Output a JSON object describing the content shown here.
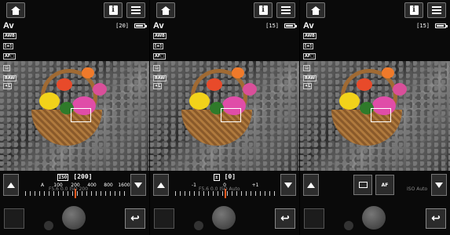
{
  "panels": [
    {
      "mode": "Av",
      "shots": "[20]",
      "setting_tag": "ISO",
      "setting_value": "[200]",
      "scale_labels": [
        "A",
        "100",
        "200",
        "400",
        "800",
        "1600"
      ],
      "ghost_text": "F5.6   0.0  ISO 200"
    },
    {
      "mode": "Av",
      "shots": "[15]",
      "setting_tag": "±",
      "setting_value": "[0]",
      "scale_labels": [
        "-1",
        "",
        "0",
        "",
        "+1"
      ],
      "ghost_text": "F5.6   0.0   ISO Auto"
    },
    {
      "mode": "Av",
      "shots": "[15]",
      "af_label": "AF",
      "ghost_text": "ISO Auto"
    }
  ],
  "icons": {
    "home": "home-icon",
    "info": "info-icon",
    "menu": "menu-icon",
    "back": "back-arrow-icon"
  },
  "side_icons": [
    "AWB",
    "[≡]",
    "AF□",
    "▤",
    "RAW",
    "✦L"
  ],
  "colors": {
    "needle": "#ff5a1e",
    "button_bg": "#2b2b2b"
  }
}
